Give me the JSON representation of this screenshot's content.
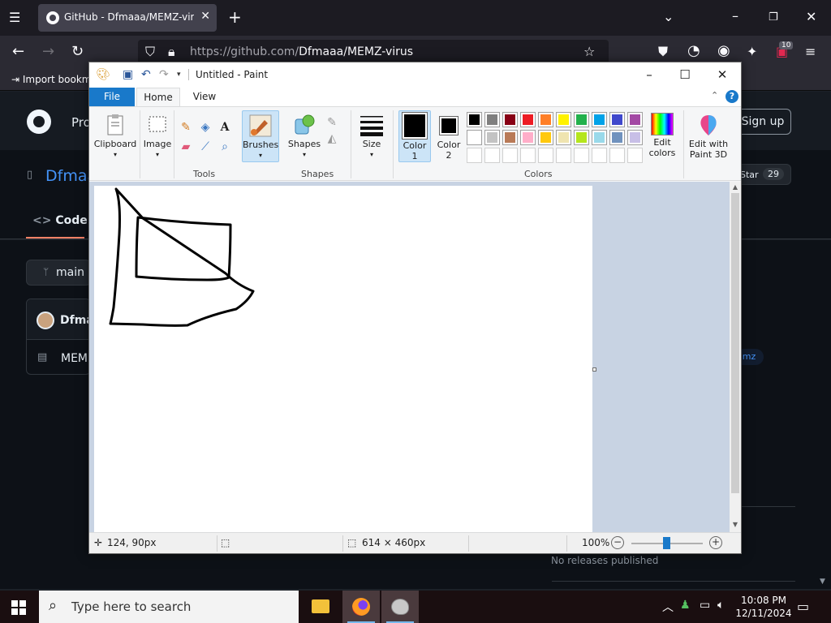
{
  "browser": {
    "tab_title": "GitHub - Dfmaaa/MEMZ-virus",
    "url_host": "https://github.com/",
    "url_path": "Dfmaaa/MEMZ-virus",
    "bookmark_label": "Import bookm",
    "extension_badge": "10"
  },
  "github": {
    "nav_partial": "Pro",
    "sign_up": "Sign up",
    "repo_owner_partial": "Dfmaa",
    "code_tab": "Code",
    "branch": "main",
    "commit_author_partial": "Dfma",
    "file_partial": "MEM",
    "star_label": "Star",
    "star_count": "29",
    "topic_partial": "mz",
    "releases_text": "No releases published"
  },
  "paint": {
    "window_title": "Untitled - Paint",
    "tabs": {
      "file": "File",
      "home": "Home",
      "view": "View"
    },
    "groups": {
      "clipboard": "Clipboard",
      "image": "Image",
      "tools": "Tools",
      "brushes": "Brushes",
      "shapes_btn": "Shapes",
      "shapes": "Shapes",
      "size": "Size",
      "color1": "Color",
      "color1_num": "1",
      "color2": "Color",
      "color2_num": "2",
      "edit_colors_1": "Edit",
      "edit_colors_2": "colors",
      "paint3d_1": "Edit with",
      "paint3d_2": "Paint 3D",
      "colors": "Colors"
    },
    "palette_row1": [
      "#000000",
      "#7f7f7f",
      "#880015",
      "#ed1c24",
      "#ff7f27",
      "#fff200",
      "#22b14c",
      "#00a2e8",
      "#3f48cc",
      "#a349a4"
    ],
    "palette_row2": [
      "#ffffff",
      "#c3c3c3",
      "#b97a57",
      "#ffaec9",
      "#ffc90e",
      "#efe4b0",
      "#b5e61d",
      "#99d9ea",
      "#7092be",
      "#c8bfe7"
    ],
    "color1_value": "#000000",
    "color2_value": "#000000",
    "status": {
      "cursor_pos": "124, 90px",
      "canvas_size": "614 × 460px",
      "zoom": "100%"
    }
  },
  "taskbar": {
    "search_placeholder": "Type here to search",
    "time": "10:08 PM",
    "date": "12/11/2024"
  }
}
